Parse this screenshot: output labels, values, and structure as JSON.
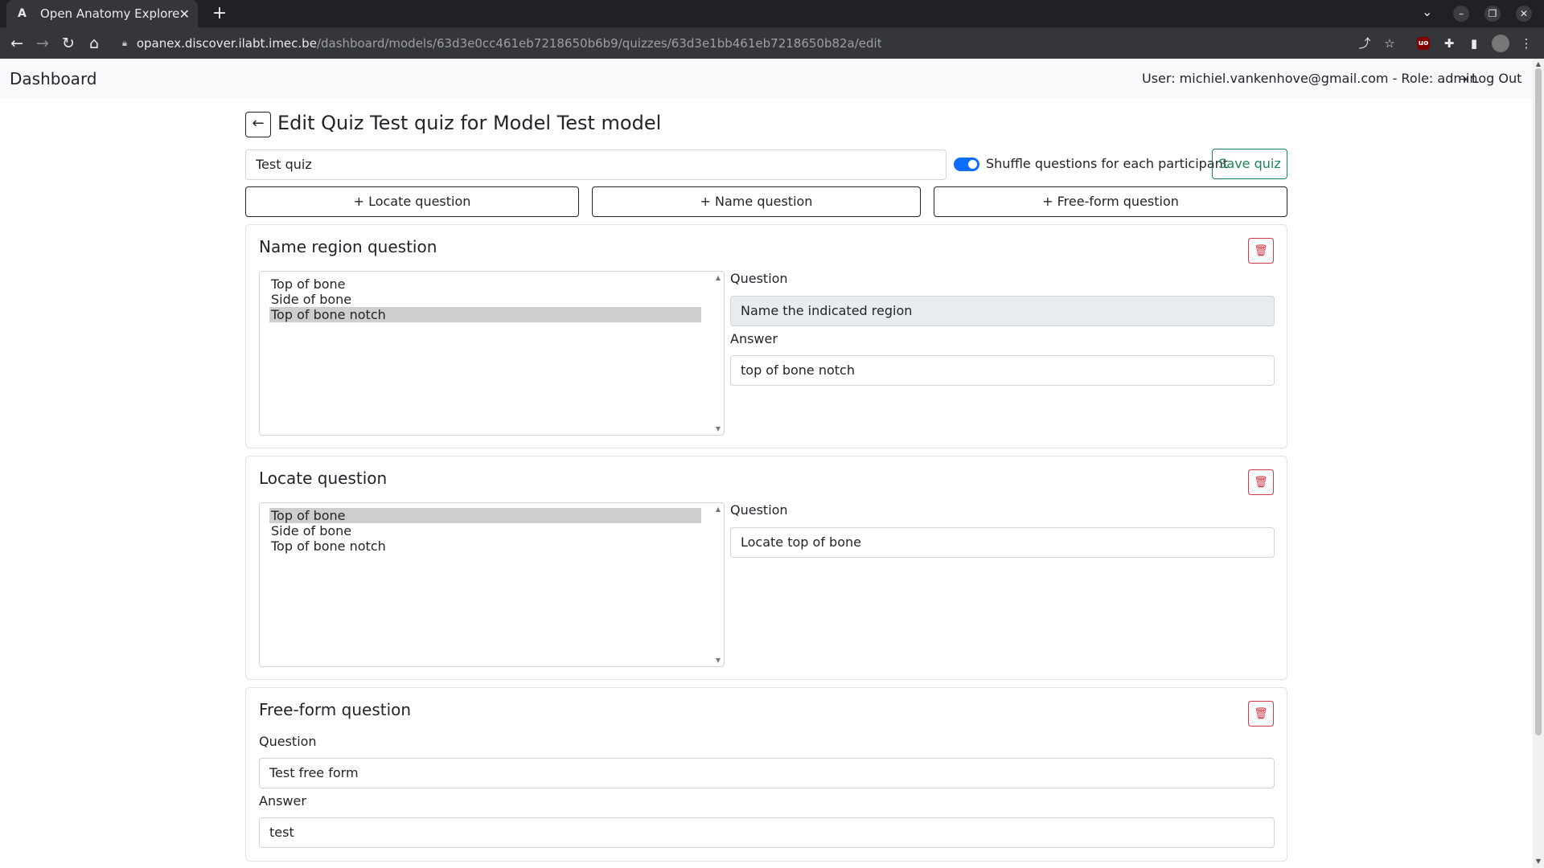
{
  "browser": {
    "tab_title": "Open Anatomy Explorer",
    "tab_favicon": "A",
    "url_host": "opanex.discover.ilabt.imec.be",
    "url_path": "/dashboard/models/63d3e0cc461eb7218650b6b9/quizzes/63d3e1bb461eb7218650b82a/edit"
  },
  "navbar": {
    "brand": "Dashboard",
    "user_info": "User: michiel.vankenhove@gmail.com - Role: admin",
    "logout_label": "Log Out"
  },
  "page": {
    "title": "Edit Quiz Test quiz for Model Test model",
    "quiz_name_value": "Test quiz",
    "shuffle_label": "Shuffle questions for each participant",
    "shuffle_on": true,
    "save_label": "Save quiz",
    "add_buttons": {
      "locate": "Locate question",
      "name": "Name question",
      "freeform": "Free-form question"
    }
  },
  "questions": [
    {
      "title": "Name region question",
      "regions": [
        "Top of bone",
        "Side of bone",
        "Top of bone notch"
      ],
      "selected_region": "Top of bone notch",
      "question_label": "Question",
      "question_value": "Name the indicated region",
      "answer_label": "Answer",
      "answer_value": "top of bone notch"
    },
    {
      "title": "Locate question",
      "regions": [
        "Top of bone",
        "Side of bone",
        "Top of bone notch"
      ],
      "selected_region": "Top of bone",
      "question_label": "Question",
      "question_value": "Locate top of bone"
    },
    {
      "title": "Free-form question",
      "question_label": "Question",
      "question_value": "Test free form",
      "answer_label": "Answer",
      "answer_value": "test"
    }
  ],
  "colors": {
    "primary": "#0d6efd",
    "success": "#198754",
    "danger": "#dc3545"
  }
}
